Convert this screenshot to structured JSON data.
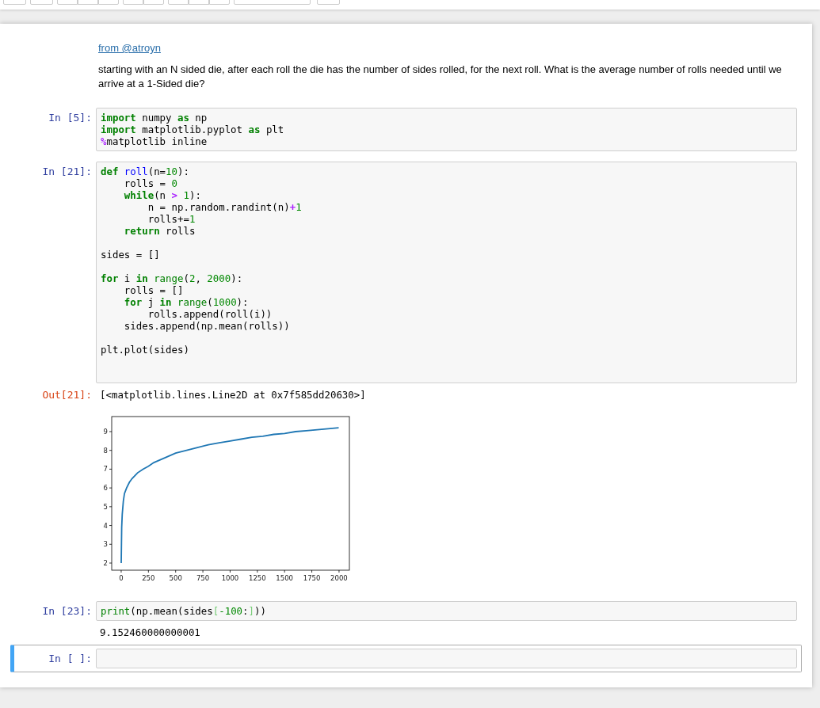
{
  "toolbar": {
    "buttons": [
      {
        "kind": "single"
      },
      {
        "kind": "single"
      },
      {
        "kind": "left"
      },
      {
        "kind": "middle"
      },
      {
        "kind": "right"
      },
      {
        "kind": "left"
      },
      {
        "kind": "right"
      },
      {
        "kind": "left"
      },
      {
        "kind": "middle"
      },
      {
        "kind": "right"
      },
      {
        "kind": "select"
      },
      {
        "kind": "single"
      }
    ]
  },
  "cells": [
    {
      "kind": "markdown",
      "selected": false,
      "link": "from @atroyn",
      "paragraph": "starting with an N sided die, after each roll the die has the number of sides rolled, for the next roll. What is the average number of rolls needed until we arrive at a 1-Sided die?"
    },
    {
      "kind": "code",
      "selected": false,
      "prompt": "In [5]:",
      "lines": [
        {
          "kind": "code",
          "tokens": [
            {
              "text": "import",
              "kind": "kw"
            },
            {
              "text": " numpy ",
              "kind": "plain"
            },
            {
              "text": "as",
              "kind": "kw"
            },
            {
              "text": " np",
              "kind": "plain"
            }
          ]
        },
        {
          "kind": "code",
          "tokens": [
            {
              "text": "import",
              "kind": "kw"
            },
            {
              "text": " matplotlib.pyplot ",
              "kind": "plain"
            },
            {
              "text": "as",
              "kind": "kw"
            },
            {
              "text": " plt",
              "kind": "plain"
            }
          ]
        },
        {
          "kind": "code",
          "tokens": [
            {
              "text": "%",
              "kind": "op"
            },
            {
              "text": "matplotlib inline",
              "kind": "plain"
            }
          ]
        }
      ]
    },
    {
      "kind": "code",
      "selected": false,
      "prompt": "In [21]:",
      "lines": [
        {
          "kind": "code",
          "tokens": [
            {
              "text": "def ",
              "kind": "kw"
            },
            {
              "text": "roll",
              "kind": "def"
            },
            {
              "text": "(n=",
              "kind": "plain"
            },
            {
              "text": "10",
              "kind": "num"
            },
            {
              "text": "):",
              "kind": "plain"
            }
          ]
        },
        {
          "kind": "code",
          "tokens": [
            {
              "text": "    rolls = ",
              "kind": "plain"
            },
            {
              "text": "0",
              "kind": "num"
            }
          ]
        },
        {
          "kind": "code",
          "tokens": [
            {
              "text": "    while",
              "kind": "kw"
            },
            {
              "text": "(n ",
              "kind": "plain"
            },
            {
              "text": "> ",
              "kind": "op"
            },
            {
              "text": "1",
              "kind": "num"
            },
            {
              "text": "):",
              "kind": "plain"
            }
          ]
        },
        {
          "kind": "code",
          "tokens": [
            {
              "text": "        n = np.random.randint(n)",
              "kind": "plain"
            },
            {
              "text": "+",
              "kind": "op"
            },
            {
              "text": "1",
              "kind": "num"
            }
          ]
        },
        {
          "kind": "code",
          "tokens": [
            {
              "text": "        rolls+=",
              "kind": "plain"
            },
            {
              "text": "1",
              "kind": "num"
            }
          ]
        },
        {
          "kind": "code",
          "tokens": [
            {
              "text": "    return",
              "kind": "kw"
            },
            {
              "text": " rolls",
              "kind": "plain"
            }
          ]
        },
        {
          "kind": "blank"
        },
        {
          "kind": "code",
          "tokens": [
            {
              "text": "sides = []",
              "kind": "plain"
            }
          ]
        },
        {
          "kind": "blank"
        },
        {
          "kind": "code",
          "tokens": [
            {
              "text": "for",
              "kind": "kw"
            },
            {
              "text": " i ",
              "kind": "plain"
            },
            {
              "text": "in",
              "kind": "kw"
            },
            {
              "text": " range",
              "kind": "builtin"
            },
            {
              "text": "(",
              "kind": "plain"
            },
            {
              "text": "2",
              "kind": "num"
            },
            {
              "text": ", ",
              "kind": "plain"
            },
            {
              "text": "2000",
              "kind": "num"
            },
            {
              "text": "):",
              "kind": "plain"
            }
          ]
        },
        {
          "kind": "code",
          "tokens": [
            {
              "text": "    rolls = []",
              "kind": "plain"
            }
          ]
        },
        {
          "kind": "code",
          "tokens": [
            {
              "text": "    for",
              "kind": "kw"
            },
            {
              "text": " j ",
              "kind": "plain"
            },
            {
              "text": "in",
              "kind": "kw"
            },
            {
              "text": " range",
              "kind": "builtin"
            },
            {
              "text": "(",
              "kind": "plain"
            },
            {
              "text": "1000",
              "kind": "num"
            },
            {
              "text": "):",
              "kind": "plain"
            }
          ]
        },
        {
          "kind": "code",
          "tokens": [
            {
              "text": "        rolls.append(roll(i))",
              "kind": "plain"
            }
          ]
        },
        {
          "kind": "code",
          "tokens": [
            {
              "text": "    sides.append(np.mean(rolls))",
              "kind": "plain"
            }
          ]
        },
        {
          "kind": "blank"
        },
        {
          "kind": "code",
          "tokens": [
            {
              "text": "plt.plot(sides)",
              "kind": "plain"
            }
          ]
        },
        {
          "kind": "blank"
        },
        {
          "kind": "blank"
        }
      ],
      "output": {
        "prompt": "Out[21]:",
        "text": "[<matplotlib.lines.Line2D at 0x7f585dd20630>]",
        "chart_data": {
          "type": "line",
          "x": [
            0,
            5,
            10,
            20,
            30,
            50,
            75,
            100,
            150,
            200,
            250,
            300,
            400,
            500,
            600,
            700,
            800,
            900,
            1000,
            1100,
            1200,
            1300,
            1400,
            1500,
            1600,
            1700,
            1800,
            1900,
            1997
          ],
          "series": [
            {
              "color": "#1f77b4",
              "values": [
                2.0,
                3.9,
                4.6,
                5.3,
                5.7,
                6.0,
                6.3,
                6.5,
                6.8,
                7.0,
                7.15,
                7.35,
                7.6,
                7.85,
                8.0,
                8.15,
                8.3,
                8.4,
                8.5,
                8.6,
                8.7,
                8.75,
                8.85,
                8.9,
                9.0,
                9.05,
                9.1,
                9.15,
                9.2
              ]
            }
          ],
          "xlim": [
            -87,
            2095
          ],
          "ylim": [
            1.62,
            9.8
          ],
          "xticks": [
            {
              "value": 0,
              "label": "0"
            },
            {
              "value": 250,
              "label": "250"
            },
            {
              "value": 500,
              "label": "500"
            },
            {
              "value": 750,
              "label": "750"
            },
            {
              "value": 1000,
              "label": "1000"
            },
            {
              "value": 1250,
              "label": "1250"
            },
            {
              "value": 1500,
              "label": "1500"
            },
            {
              "value": 1750,
              "label": "1750"
            },
            {
              "value": 2000,
              "label": "2000"
            }
          ],
          "yticks": [
            {
              "value": 2,
              "label": "2"
            },
            {
              "value": 3,
              "label": "3"
            },
            {
              "value": 4,
              "label": "4"
            },
            {
              "value": 5,
              "label": "5"
            },
            {
              "value": 6,
              "label": "6"
            },
            {
              "value": 7,
              "label": "7"
            },
            {
              "value": 8,
              "label": "8"
            },
            {
              "value": 9,
              "label": "9"
            }
          ]
        }
      }
    },
    {
      "kind": "code",
      "selected": false,
      "prompt": "In [23]:",
      "lines": [
        {
          "kind": "code",
          "tokens": [
            {
              "text": "print",
              "kind": "builtin"
            },
            {
              "text": "(np.mean(sides",
              "kind": "plain"
            },
            {
              "text": "[",
              "kind": "match"
            },
            {
              "text": "-100",
              "kind": "num"
            },
            {
              "text": ":",
              "kind": "plain"
            },
            {
              "text": "]",
              "kind": "match"
            },
            {
              "text": "))",
              "kind": "plain"
            }
          ]
        }
      ],
      "output": {
        "text": "9.152460000000001"
      }
    },
    {
      "kind": "code",
      "selected": true,
      "prompt": "In [ ]:",
      "lines": [
        {
          "kind": "blank"
        }
      ]
    }
  ]
}
